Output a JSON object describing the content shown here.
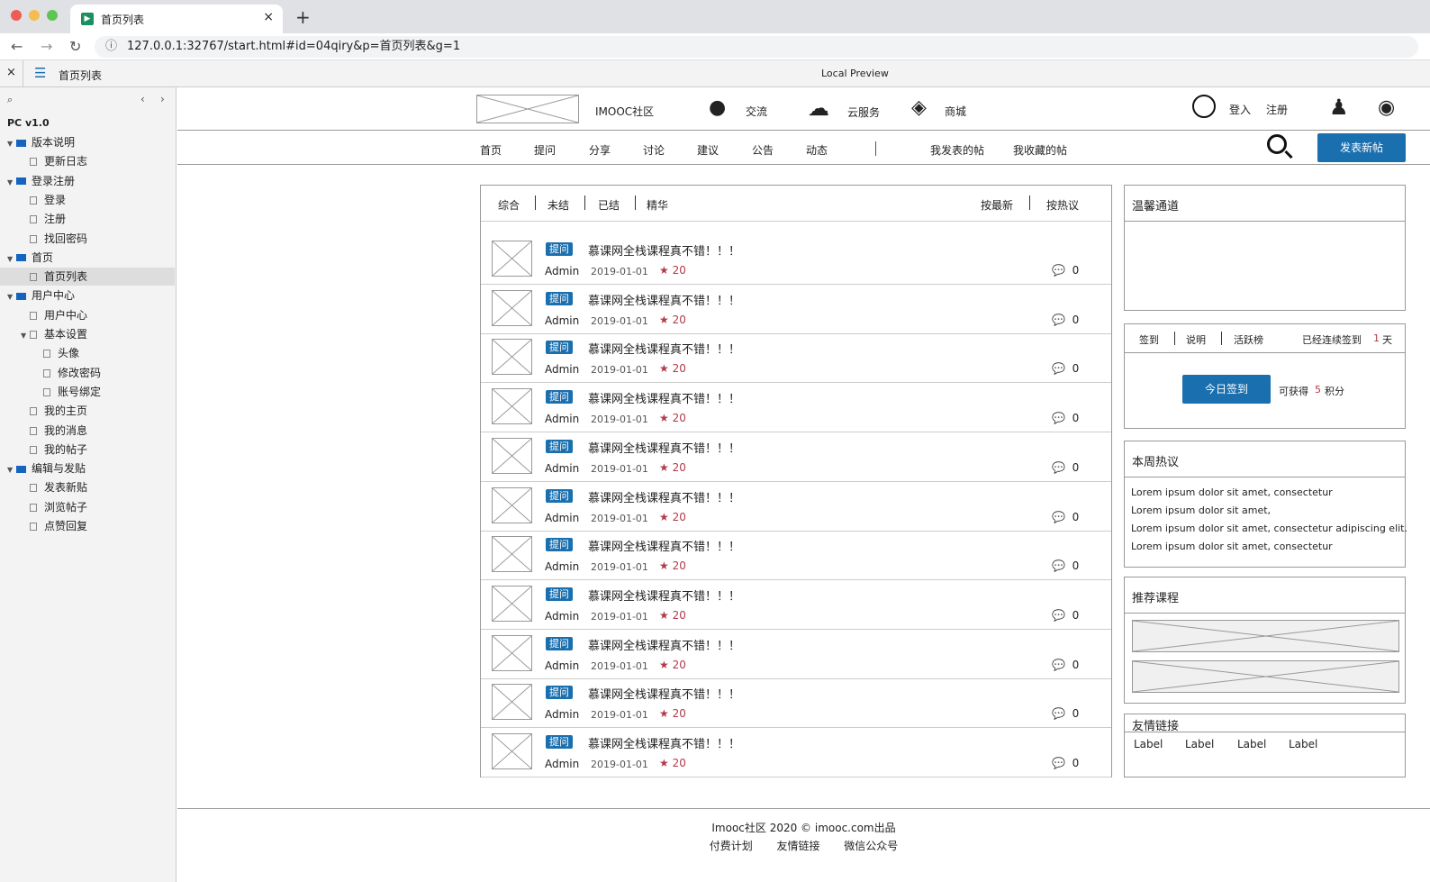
{
  "browser": {
    "tab_title": "首页列表",
    "url": "127.0.0.1:32767/start.html#id=04qiry&p=首页列表&g=1"
  },
  "preview": {
    "page_name": "首页列表",
    "center_title": "Local Preview"
  },
  "sidebar": {
    "version": "PC v1.0",
    "items": [
      {
        "label": "版本说明",
        "type": "folder",
        "level": 0
      },
      {
        "label": "更新日志",
        "type": "page",
        "level": 1
      },
      {
        "label": "登录注册",
        "type": "folder",
        "level": 0
      },
      {
        "label": "登录",
        "type": "page",
        "level": 1
      },
      {
        "label": "注册",
        "type": "page",
        "level": 1
      },
      {
        "label": "找回密码",
        "type": "page",
        "level": 1
      },
      {
        "label": "首页",
        "type": "folder",
        "level": 0
      },
      {
        "label": "首页列表",
        "type": "page",
        "level": 1,
        "selected": true
      },
      {
        "label": "用户中心",
        "type": "folder",
        "level": 0
      },
      {
        "label": "用户中心",
        "type": "page",
        "level": 1
      },
      {
        "label": "基本设置",
        "type": "pagefolder",
        "level": 1
      },
      {
        "label": "头像",
        "type": "page",
        "level": 2
      },
      {
        "label": "修改密码",
        "type": "page",
        "level": 2
      },
      {
        "label": "账号绑定",
        "type": "page",
        "level": 2
      },
      {
        "label": "我的主页",
        "type": "page",
        "level": 1
      },
      {
        "label": "我的消息",
        "type": "page",
        "level": 1
      },
      {
        "label": "我的帖子",
        "type": "page",
        "level": 1
      },
      {
        "label": "编辑与发贴",
        "type": "folder",
        "level": 0
      },
      {
        "label": "发表新贴",
        "type": "page",
        "level": 1
      },
      {
        "label": "浏览帖子",
        "type": "page",
        "level": 1
      },
      {
        "label": "点赞回复",
        "type": "page",
        "level": 1
      }
    ]
  },
  "header": {
    "brand": "IMOOC社区",
    "links": [
      "交流",
      "云服务",
      "商城"
    ],
    "login": "登入",
    "register": "注册"
  },
  "nav": {
    "items": [
      "首页",
      "提问",
      "分享",
      "讨论",
      "建议",
      "公告",
      "动态"
    ],
    "my_posts": "我发表的帖",
    "my_favs": "我收藏的帖",
    "new_post": "发表新帖"
  },
  "filters": {
    "tabs": [
      "综合",
      "未结",
      "已结",
      "精华"
    ],
    "sort": [
      "按最新",
      "按热议"
    ]
  },
  "posts": [
    {
      "badge": "提问",
      "title": "慕课网全栈课程真不错！！！",
      "author": "Admin",
      "date": "2019-01-01",
      "stars": "20",
      "comments": "0"
    },
    {
      "badge": "提问",
      "title": "慕课网全栈课程真不错！！！",
      "author": "Admin",
      "date": "2019-01-01",
      "stars": "20",
      "comments": "0"
    },
    {
      "badge": "提问",
      "title": "慕课网全栈课程真不错！！！",
      "author": "Admin",
      "date": "2019-01-01",
      "stars": "20",
      "comments": "0"
    },
    {
      "badge": "提问",
      "title": "慕课网全栈课程真不错！！！",
      "author": "Admin",
      "date": "2019-01-01",
      "stars": "20",
      "comments": "0"
    },
    {
      "badge": "提问",
      "title": "慕课网全栈课程真不错！！！",
      "author": "Admin",
      "date": "2019-01-01",
      "stars": "20",
      "comments": "0"
    },
    {
      "badge": "提问",
      "title": "慕课网全栈课程真不错！！！",
      "author": "Admin",
      "date": "2019-01-01",
      "stars": "20",
      "comments": "0"
    },
    {
      "badge": "提问",
      "title": "慕课网全栈课程真不错！！！",
      "author": "Admin",
      "date": "2019-01-01",
      "stars": "20",
      "comments": "0"
    },
    {
      "badge": "提问",
      "title": "慕课网全栈课程真不错！！！",
      "author": "Admin",
      "date": "2019-01-01",
      "stars": "20",
      "comments": "0"
    },
    {
      "badge": "提问",
      "title": "慕课网全栈课程真不错！！！",
      "author": "Admin",
      "date": "2019-01-01",
      "stars": "20",
      "comments": "0"
    },
    {
      "badge": "提问",
      "title": "慕课网全栈课程真不错！！！",
      "author": "Admin",
      "date": "2019-01-01",
      "stars": "20",
      "comments": "0"
    },
    {
      "badge": "提问",
      "title": "慕课网全栈课程真不错！！！",
      "author": "Admin",
      "date": "2019-01-01",
      "stars": "20",
      "comments": "0"
    }
  ],
  "right": {
    "warm_title": "温馨通道",
    "signin_tabs": [
      "签到",
      "说明",
      "活跃榜"
    ],
    "signin_streak": "已经连续签到",
    "streak_days": "1",
    "streak_unit": "天",
    "signin_button": "今日签到",
    "reward_prefix": "可获得",
    "reward_points": "5",
    "reward_suffix": "积分",
    "hot_title": "本周热议",
    "hot_items": [
      "Lorem ipsum dolor sit amet, consectetur",
      "Lorem ipsum dolor sit amet,",
      "Lorem ipsum dolor sit amet, consectetur adipiscing elit.",
      "Lorem ipsum dolor sit amet, consectetur"
    ],
    "course_title": "推荐课程",
    "links_title": "友情链接",
    "links": [
      "Label",
      "Label",
      "Label",
      "Label"
    ]
  },
  "footer": {
    "copyright": "Imooc社区 2020 © imooc.com出品",
    "links": [
      "付费计划",
      "友情链接",
      "微信公众号"
    ]
  },
  "colors": {
    "accent": "#1a6faf",
    "star": "#b03a48"
  }
}
